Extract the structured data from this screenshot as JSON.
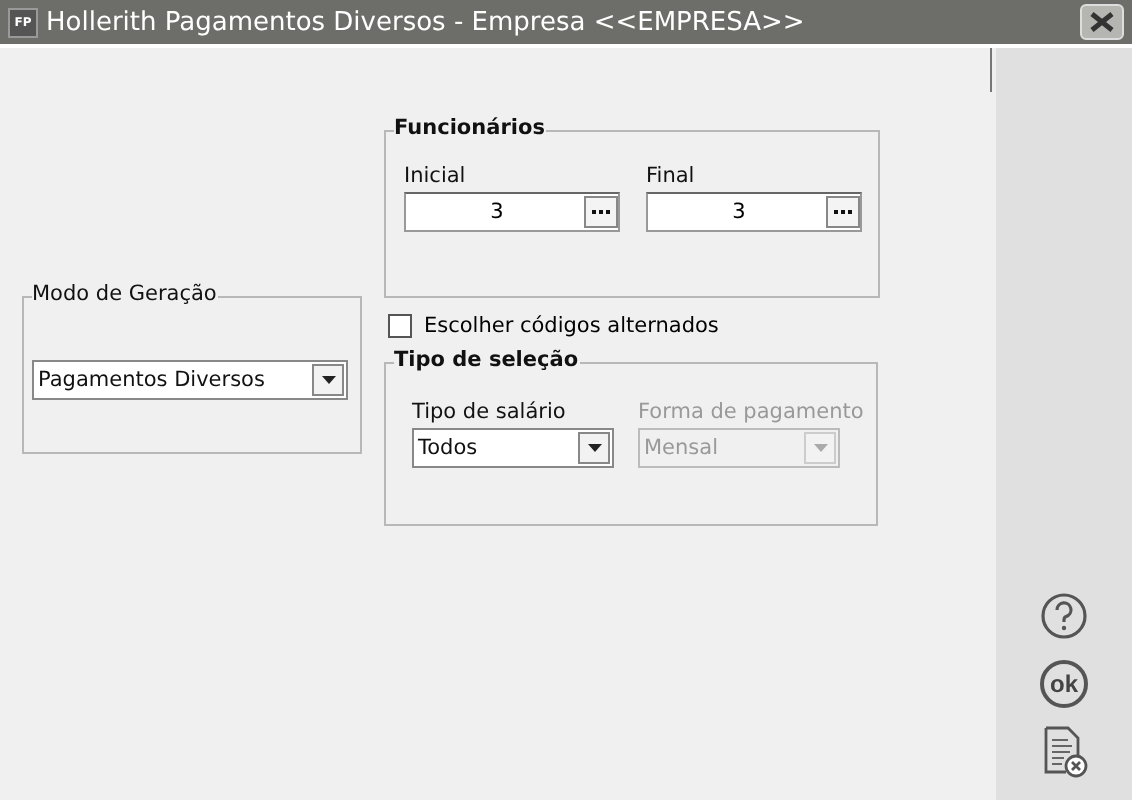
{
  "window": {
    "badge": "FP",
    "title": "Hollerith Pagamentos Diversos - Empresa <<EMPRESA>>"
  },
  "modo_geracao": {
    "title": "Modo de Geração",
    "value": "Pagamentos Diversos",
    "disabled": false
  },
  "funcionarios": {
    "title": "Funcionários",
    "fields": [
      {
        "label": "Inicial",
        "value": "3"
      },
      {
        "label": "Final",
        "value": "3"
      }
    ]
  },
  "escolher_codigos": {
    "label": "Escolher códigos alternados",
    "checked": false
  },
  "tipo_selecao": {
    "title": "Tipo de seleção",
    "fields": [
      {
        "label": "Tipo de salário",
        "value": "Todos",
        "disabled": false
      },
      {
        "label": "Forma de pagamento",
        "value": "Mensal",
        "disabled": true
      }
    ]
  },
  "side_buttons": [
    {
      "kind": "help"
    },
    {
      "kind": "ok",
      "label": "ok"
    },
    {
      "kind": "cancel"
    }
  ]
}
